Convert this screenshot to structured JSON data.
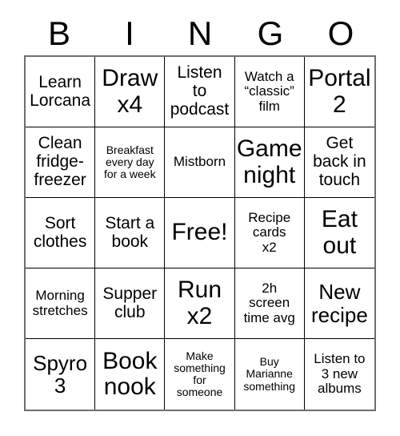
{
  "card": {
    "title": "BINGO",
    "header_letters": [
      "B",
      "I",
      "N",
      "G",
      "O"
    ],
    "columns": 5,
    "rows": 5,
    "free_space_index": 12,
    "border_color": "#000000",
    "outer_border_color": "#6e6e6e",
    "background_color": "#ffffff",
    "text_color": "#000000",
    "cells": [
      {
        "text": "Learn\nLorcana",
        "size": "md"
      },
      {
        "text": "Draw\nx4",
        "size": "xl"
      },
      {
        "text": "Listen\nto\npodcast",
        "size": "md"
      },
      {
        "text": "Watch a\n“classic”\nfilm",
        "size": "sm"
      },
      {
        "text": "Portal\n2",
        "size": "xl"
      },
      {
        "text": "Clean\nfridge-\nfreezer",
        "size": "md"
      },
      {
        "text": "Breakfast\nevery day\nfor a week",
        "size": "xs"
      },
      {
        "text": "Mistborn",
        "size": "sm"
      },
      {
        "text": "Game\nnight",
        "size": "xl"
      },
      {
        "text": "Get\nback in\ntouch",
        "size": "md"
      },
      {
        "text": "Sort\nclothes",
        "size": "md"
      },
      {
        "text": "Start a\nbook",
        "size": "md"
      },
      {
        "text": "Free!",
        "size": "xl"
      },
      {
        "text": "Recipe\ncards\nx2",
        "size": "sm"
      },
      {
        "text": "Eat\nout",
        "size": "xl"
      },
      {
        "text": "Morning\nstretches",
        "size": "sm"
      },
      {
        "text": "Supper\nclub",
        "size": "md"
      },
      {
        "text": "Run\nx2",
        "size": "xl"
      },
      {
        "text": "2h\nscreen\ntime avg",
        "size": "sm"
      },
      {
        "text": "New\nrecipe",
        "size": "lg"
      },
      {
        "text": "Spyro\n3",
        "size": "lg"
      },
      {
        "text": "Book\nnook",
        "size": "xl"
      },
      {
        "text": "Make\nsomething\nfor\nsomeone",
        "size": "xs"
      },
      {
        "text": "Buy\nMarianne\nsomething",
        "size": "xs"
      },
      {
        "text": "Listen to\n3 new\nalbums",
        "size": "sm"
      }
    ]
  }
}
